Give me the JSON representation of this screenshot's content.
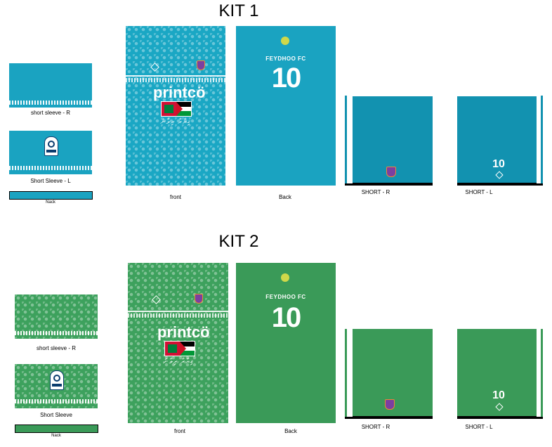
{
  "kits": [
    {
      "title": "KIT 1",
      "colors": {
        "main": "#1aa7c4",
        "dark": "#1292b0"
      },
      "labels": {
        "sleeve_r": "short sleeve - R",
        "sleeve_l": "Short Sleeve - L",
        "neck": "Nack",
        "front": "front",
        "back": "Back",
        "short_r": "SHORT - R",
        "short_l": "SHORT - L"
      },
      "sponsor": "printcö",
      "club_name": "FEYDHOO FC",
      "number": "10",
      "short_number": "10",
      "thaana": "ޤިޔާރާ ރިލާނު"
    },
    {
      "title": "KIT 2",
      "colors": {
        "main": "#3da15d",
        "dark": "#2f9050"
      },
      "labels": {
        "sleeve_r": "short sleeve - R",
        "sleeve_l": "Short Sleeve",
        "neck": "Nack",
        "front": "front",
        "back": "Back",
        "short_r": "SHORT - R",
        "short_l": "SHORT - L"
      },
      "sponsor": "printcö",
      "club_name": "FEYDHOO FC",
      "number": "10",
      "short_number": "10",
      "thaana": "ޤިޔާރާ ރިލާނު"
    }
  ]
}
